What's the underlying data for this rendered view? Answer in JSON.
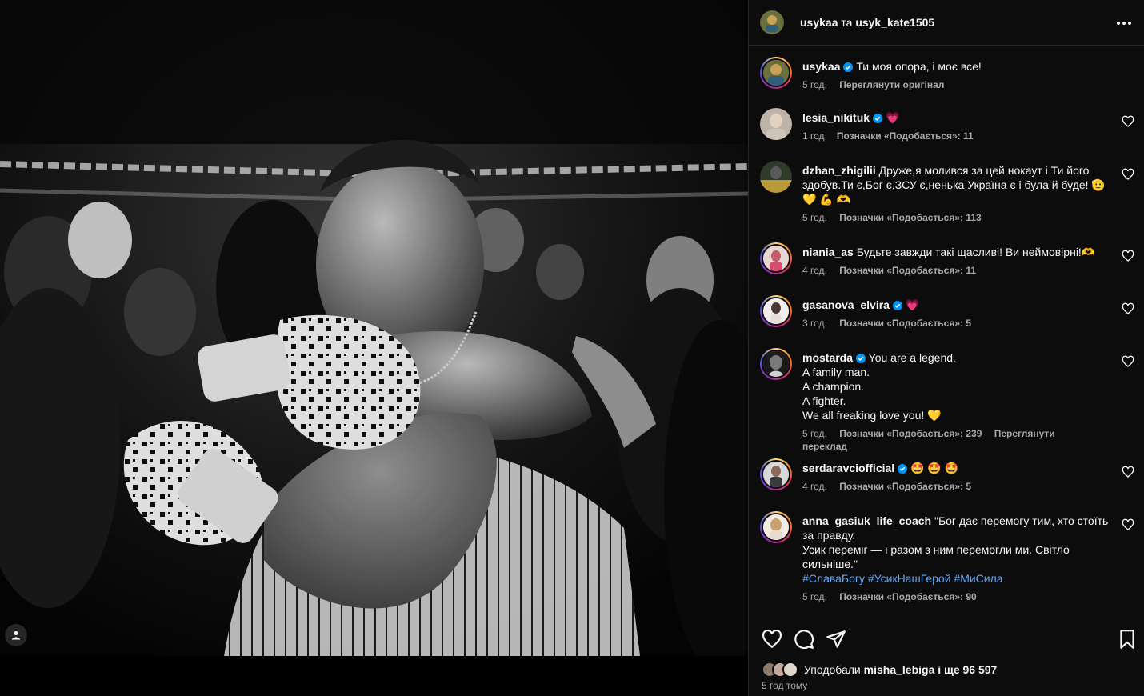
{
  "header": {
    "author": "usykaa",
    "conjunction": "та",
    "coauthor": "usyk_kate1505"
  },
  "caption": {
    "username": "usykaa",
    "text": "Ти моя опора, і моє все!",
    "time": "5 год.",
    "action": "Переглянути оригінал"
  },
  "comments": [
    {
      "username": "lesia_nikituk",
      "verified": true,
      "text": "💗",
      "time": "1 год",
      "likes": "Позначки «Подобається»: 11",
      "extra": ""
    },
    {
      "username": "dzhan_zhigilii",
      "verified": false,
      "text": "Друже,я молився за цей нокаут і Ти його здобув.Ти є,Бог є,ЗСУ є,ненька Україна є і була й буде! 🫡 💛 💪 🫶",
      "time": "5 год.",
      "likes": "Позначки «Подобається»: 113",
      "extra": ""
    },
    {
      "username": "niania_as",
      "verified": false,
      "text": "Будьте завжди такі щасливі! Ви неймовірні!🫶",
      "time": "4 год.",
      "likes": "Позначки «Подобається»: 11",
      "extra": ""
    },
    {
      "username": "gasanova_elvira",
      "verified": true,
      "text": "💗",
      "time": "3 год.",
      "likes": "Позначки «Подобається»: 5",
      "extra": ""
    },
    {
      "username": "mostarda",
      "verified": true,
      "text_lines": [
        "You are a legend.",
        "A family man.",
        "A champion.",
        "A fighter.",
        "We all freaking love you! 💛"
      ],
      "time": "5 год.",
      "likes": "Позначки «Подобається»: 239",
      "extra": "Переглянути переклад"
    },
    {
      "username": "serdaravciofficial",
      "verified": true,
      "text": "🤩 🤩 🤩",
      "time": "4 год.",
      "likes": "Позначки «Подобається»: 5",
      "extra": ""
    },
    {
      "username": "anna_gasiuk_life_coach",
      "verified": false,
      "text_lines": [
        "\"Бог дає перемогу тим, хто стоїть за правду.",
        "Усик переміг — і разом з ним перемогли ми. Світло сильніше.\""
      ],
      "hashtags": "#СлаваБогу #УсикНашГерой #МиСила",
      "time": "5 год.",
      "likes": "Позначки «Подобається»: 90",
      "extra": ""
    }
  ],
  "likes_summary": {
    "prefix": "Уподобали",
    "user": "misha_lebiga",
    "suffix": "і ще 96 597"
  },
  "post_time": "5 год тому",
  "icons": {
    "like": "heart-icon",
    "comment": "comment-icon",
    "share": "share-icon",
    "save": "bookmark-icon",
    "more": "more-icon",
    "tag": "user-tag-icon"
  },
  "colors": {
    "panel_bg": "#0c0c0c",
    "text": "#f5f5f5",
    "muted": "#a8a8a8",
    "verified": "#0095f6",
    "hashtag": "#5ea8ff"
  }
}
